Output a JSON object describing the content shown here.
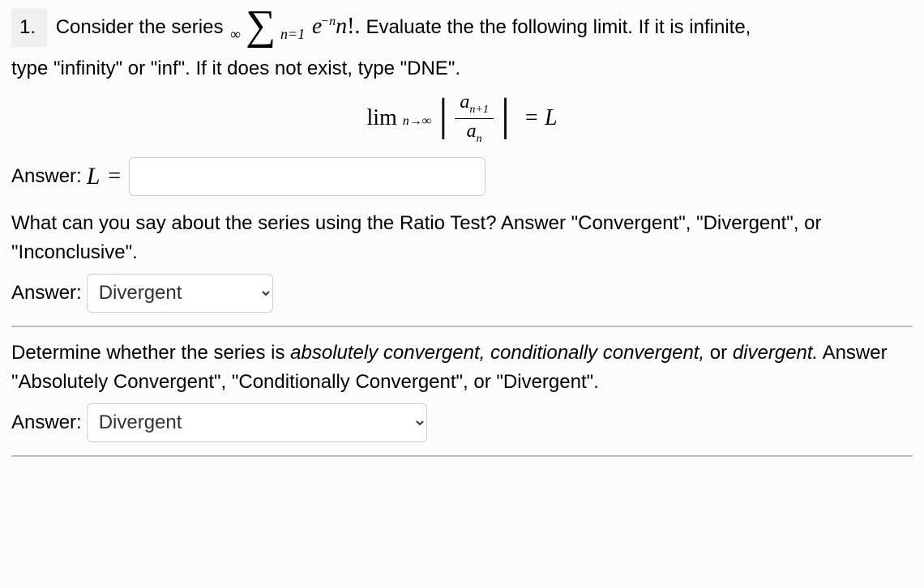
{
  "problem": {
    "number": "1.",
    "intro_a": "Consider the series",
    "series": {
      "upper": "∞",
      "sigma": "∑",
      "lower": "n=1",
      "term_base": "e",
      "term_exp": "−n",
      "term_rest": "n",
      "term_excl": "!."
    },
    "intro_b": "Evaluate the the following limit. If it is infinite,",
    "intro_c": "type \"infinity\" or \"inf\". If it does not exist, type \"DNE\".",
    "limit": {
      "lim": "lim",
      "sub": "n→∞",
      "numer_a": "a",
      "numer_sub": "n+1",
      "denom_a": "a",
      "denom_sub": "n",
      "equals": "= L"
    },
    "answer_label": "Answer:",
    "L_symbol": "L",
    "equals_symbol": "=",
    "L_input_value": "",
    "ratio_question": "What can you say about the series using the Ratio Test? Answer \"Convergent\", \"Divergent\", or \"Inconclusive\".",
    "ratio_options": [
      "Convergent",
      "Divergent",
      "Inconclusive"
    ],
    "ratio_selected": "Divergent",
    "abs_question_a": "Determine whether the series is ",
    "abs_question_italic": "absolutely convergent, conditionally convergent,",
    "abs_question_b": " or ",
    "abs_question_italic2": "divergent.",
    "abs_question_c": " Answer \"Absolutely Convergent\", \"Conditionally Convergent\", or \"Divergent\".",
    "abs_options": [
      "Absolutely Convergent",
      "Conditionally Convergent",
      "Divergent"
    ],
    "abs_selected": "Divergent"
  }
}
